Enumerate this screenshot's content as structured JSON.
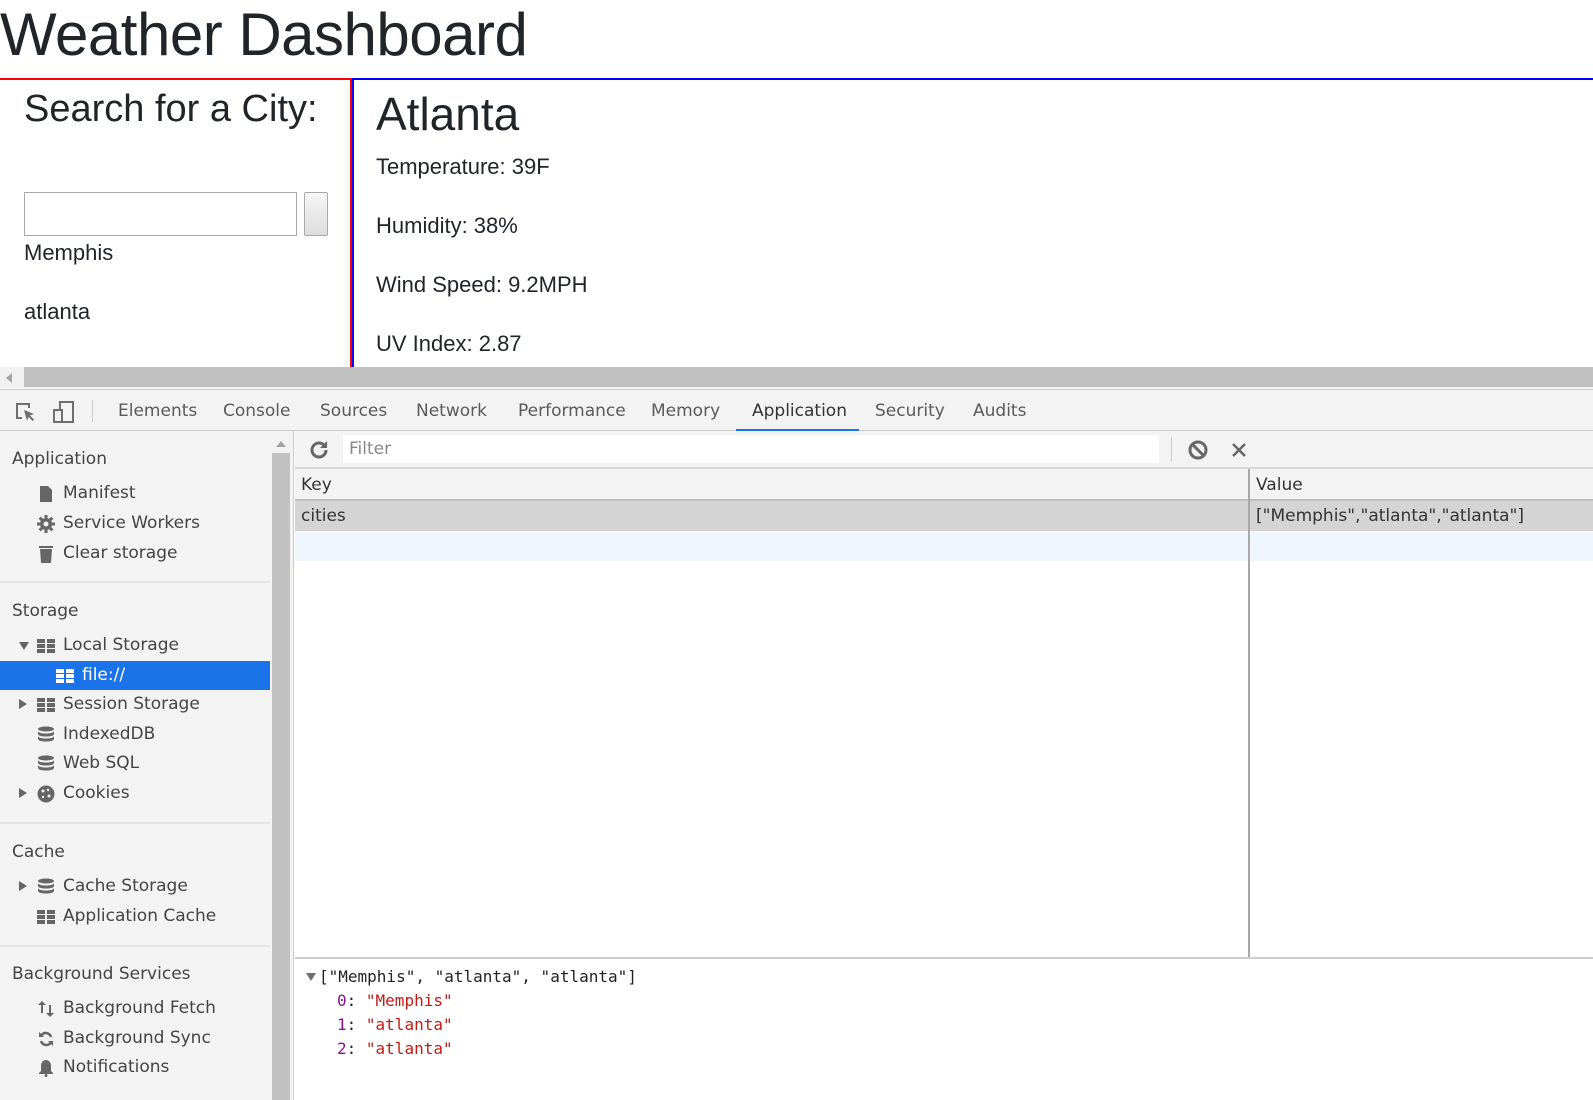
{
  "webpage": {
    "title": "Weather Dashboard",
    "search": {
      "heading": "Search for a City:",
      "input_value": "",
      "input_placeholder": "",
      "button_label": ""
    },
    "history": [
      "Memphis",
      "atlanta"
    ],
    "current": {
      "city": "Atlanta",
      "temperature": "Temperature: 39F",
      "humidity": "Humidity: 38%",
      "wind_speed": "Wind Speed: 9.2MPH",
      "uv_index": "UV Index: 2.87"
    },
    "colors": {
      "left_border": "#ff0000",
      "right_border": "#0000ff"
    }
  },
  "devtools": {
    "tabs": [
      {
        "label": "Elements"
      },
      {
        "label": "Console"
      },
      {
        "label": "Sources"
      },
      {
        "label": "Network"
      },
      {
        "label": "Performance"
      },
      {
        "label": "Memory"
      },
      {
        "label": "Application",
        "active": true
      },
      {
        "label": "Security"
      },
      {
        "label": "Audits"
      }
    ],
    "sidebar": {
      "sections": {
        "application": "Application",
        "storage": "Storage",
        "cache": "Cache",
        "background": "Background Services"
      },
      "items": {
        "manifest": "Manifest",
        "service_workers": "Service Workers",
        "clear_storage": "Clear storage",
        "local_storage": "Local Storage",
        "local_storage_origin": "file://",
        "session_storage": "Session Storage",
        "indexeddb": "IndexedDB",
        "web_sql": "Web SQL",
        "cookies": "Cookies",
        "cache_storage": "Cache Storage",
        "application_cache": "Application Cache",
        "background_fetch": "Background Fetch",
        "background_sync": "Background Sync",
        "notifications": "Notifications"
      }
    },
    "storage_view": {
      "filter_placeholder": "Filter",
      "filter_value": "",
      "columns": {
        "key": "Key",
        "value": "Value"
      },
      "rows": [
        {
          "key": "cities",
          "value": "[\"Memphis\",\"atlanta\",\"atlanta\"]"
        }
      ],
      "preview": {
        "summary": "[\"Memphis\", \"atlanta\", \"atlanta\"]",
        "entries": [
          {
            "index": "0",
            "value": "\"Memphis\""
          },
          {
            "index": "1",
            "value": "\"atlanta\""
          },
          {
            "index": "2",
            "value": "\"atlanta\""
          }
        ]
      }
    },
    "accent_color": "#1a73e8"
  }
}
